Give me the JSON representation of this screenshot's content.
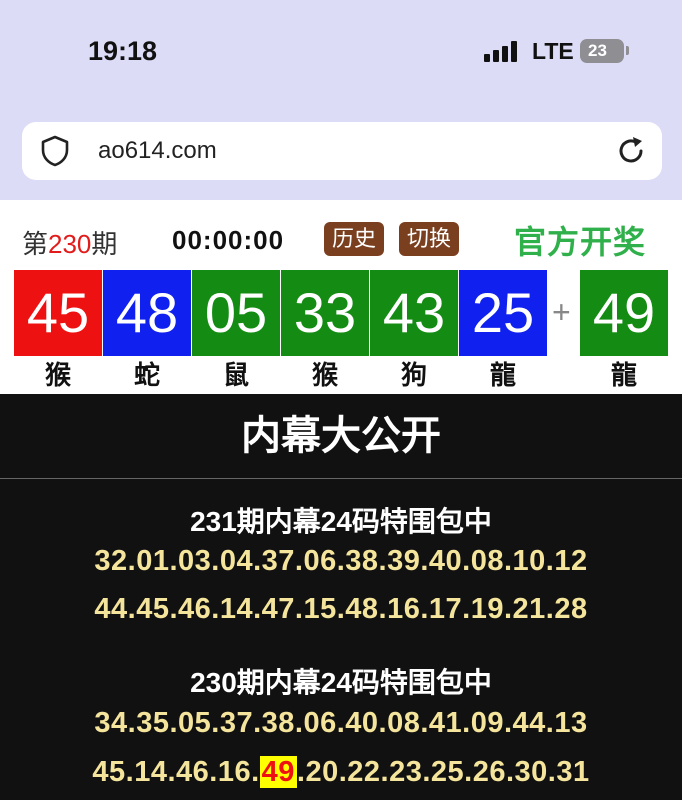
{
  "status_bar": {
    "time": "19:18",
    "network": "LTE",
    "battery": "23"
  },
  "browser": {
    "url": "ao614.com",
    "icons": [
      "shield-icon",
      "reload-icon"
    ]
  },
  "draw": {
    "issue_prefix": "第",
    "issue_number": "230",
    "issue_suffix": "期",
    "countdown": "00:00:00",
    "history_button": "历史",
    "switch_button": "切换",
    "official": "官方开奖",
    "plus": "+",
    "balls": [
      {
        "number": "45",
        "zodiac": "猴",
        "color": "red"
      },
      {
        "number": "48",
        "zodiac": "蛇",
        "color": "blue"
      },
      {
        "number": "05",
        "zodiac": "鼠",
        "color": "green"
      },
      {
        "number": "33",
        "zodiac": "猴",
        "color": "green"
      },
      {
        "number": "43",
        "zodiac": "狗",
        "color": "green"
      },
      {
        "number": "25",
        "zodiac": "龍",
        "color": "blue"
      }
    ],
    "special": {
      "number": "49",
      "zodiac": "龍",
      "color": "green"
    }
  },
  "reveal": {
    "title": "内幕大公开",
    "sections": [
      {
        "title": "231期内幕24码特围包中",
        "line1": "32.01.03.04.37.06.38.39.40.08.10.12",
        "line2": "44.45.46.14.47.15.48.16.17.19.21.28"
      },
      {
        "title": "230期内幕24码特围包中",
        "line1": "34.35.05.37.38.06.40.08.41.09.44.13",
        "line2_before": "45.14.46.16.",
        "line2_hit": "49",
        "line2_after": ".20.22.23.25.26.30.31"
      }
    ]
  },
  "colors": {
    "red": "#ee1111",
    "blue": "#1020ee",
    "green": "#148c14",
    "number_text": "#f5e59c",
    "highlight": "#ffff00"
  }
}
